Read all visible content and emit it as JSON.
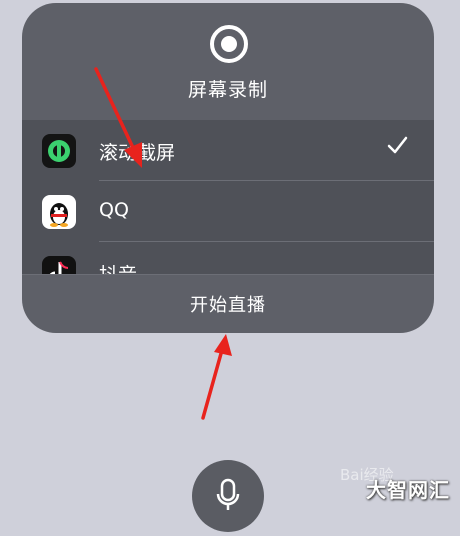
{
  "panel": {
    "title": "屏幕录制",
    "record_icon": "record-circle-icon",
    "apps": [
      {
        "label": "滚动截屏",
        "icon": "scroll-screenshot-app-icon",
        "selected": true
      },
      {
        "label": "QQ",
        "icon": "qq-penguin-icon",
        "selected": false
      },
      {
        "label": "抖音",
        "icon": "douyin-app-icon",
        "selected": false
      }
    ],
    "check_icon": "checkmark-icon",
    "start_label": "开始直播"
  },
  "mic_icon": "microphone-icon",
  "watermark": {
    "faint": "Bai经验",
    "brand": "大智网汇"
  },
  "colors": {
    "panel_bg": "#5e6068",
    "list_bg": "#4f5158",
    "page_bg": "#cfd0da",
    "arrow": "#e8231d"
  }
}
